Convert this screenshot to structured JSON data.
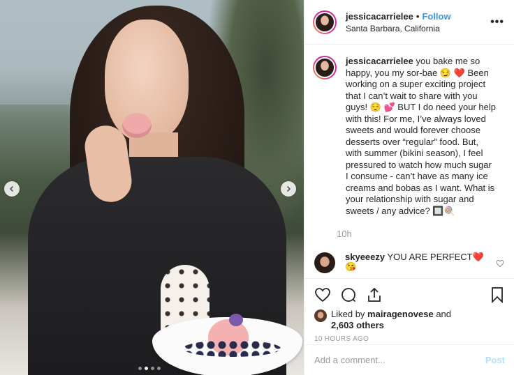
{
  "post": {
    "author": "jessicacarrielee",
    "bullet": "•",
    "follow_label": "Follow",
    "location": "Santa Barbara, California",
    "more_label": "•••",
    "carousel": {
      "slide_count": 4,
      "active_slide": 2
    }
  },
  "caption": {
    "user": "jessicacarrielee",
    "text": " you bake me so happy, you my sor-bae 😏 ❤️  Been working on a super exciting project that I can’t wait to share with you guys! 😌 💕  BUT I do need your help with this! For me, I’ve always loved sweets and would forever choose desserts over “regular” food. But, with summer (bikini season), I feel pressured to watch how much sugar I consume - can’t have as many ice creams and bobas as I want. What is your relationship with sugar and sweets / any advice? 🔲🍭",
    "time": "10h"
  },
  "comment": {
    "user": "skyeeezy",
    "text": " YOU ARE PERFECT❤️ 😘"
  },
  "likes": {
    "prefix": "Liked by ",
    "user": "mairagenovese",
    "middle": " and",
    "count": "2,603 others"
  },
  "timestamp": "10 HOURS AGO",
  "add_comment": {
    "placeholder": "Add a comment...",
    "post_label": "Post"
  },
  "icons": [
    "chevron-left-icon",
    "chevron-right-icon",
    "heart-icon",
    "comment-icon",
    "share-icon",
    "bookmark-icon",
    "more-icon"
  ],
  "colors": {
    "link": "#3897f0",
    "post_disabled": "#b2dffc",
    "heart": "#ed4956"
  }
}
